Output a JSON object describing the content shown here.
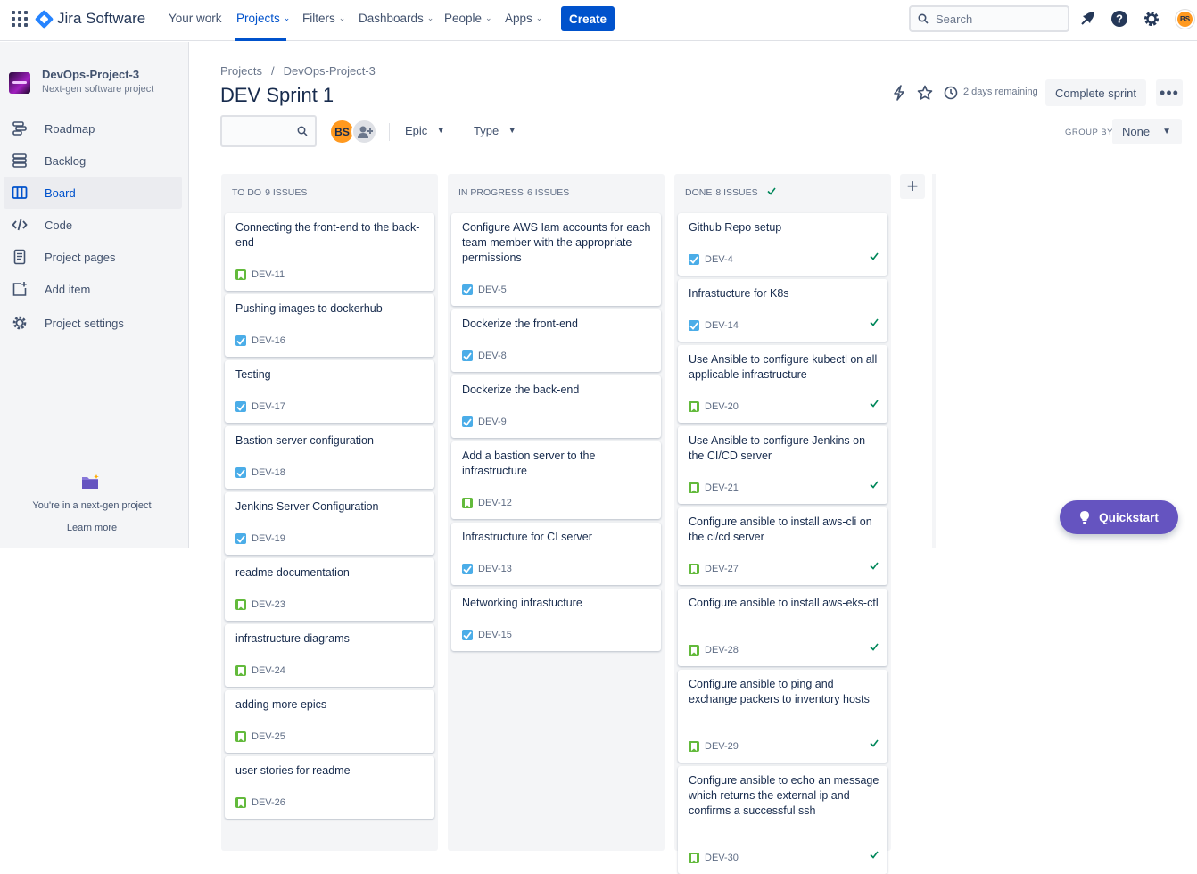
{
  "topnav": {
    "product": "Jira Software",
    "items": [
      {
        "label": "Your work",
        "chevron": false
      },
      {
        "label": "Projects",
        "chevron": true,
        "active": true
      },
      {
        "label": "Filters",
        "chevron": true
      },
      {
        "label": "Dashboards",
        "chevron": true
      },
      {
        "label": "People",
        "chevron": true
      },
      {
        "label": "Apps",
        "chevron": true
      }
    ],
    "create_label": "Create",
    "search_placeholder": "Search",
    "user_initials": "BS"
  },
  "sidebar": {
    "project_name": "DevOps-Project-3",
    "project_type": "Next-gen software project",
    "items": [
      {
        "label": "Roadmap",
        "icon": "roadmap-icon"
      },
      {
        "label": "Backlog",
        "icon": "backlog-icon"
      },
      {
        "label": "Board",
        "icon": "board-icon",
        "active": true
      },
      {
        "label": "Code",
        "icon": "code-icon"
      },
      {
        "label": "Project pages",
        "icon": "pages-icon"
      },
      {
        "label": "Add item",
        "icon": "add-item-icon"
      },
      {
        "label": "Project settings",
        "icon": "gear-icon"
      }
    ],
    "nextgen_text": "You're in a next-gen project",
    "learn_more": "Learn more"
  },
  "header": {
    "breadcrumb": [
      "Projects",
      "DevOps-Project-3"
    ],
    "title": "DEV Sprint 1",
    "days_remaining": "2 days remaining",
    "complete_sprint": "Complete sprint",
    "more_label": "•••"
  },
  "filters": {
    "search_value": "",
    "avatar_initials": "BS",
    "epic_label": "Epic",
    "type_label": "Type",
    "group_by_label": "GROUP BY",
    "group_by_value": "None"
  },
  "columns": [
    {
      "name": "TO DO",
      "count": "9 ISSUES",
      "done": false,
      "cards": [
        {
          "title": "Connecting the front-end to the back-end",
          "key": "DEV-11",
          "type": "story"
        },
        {
          "title": "Pushing images to dockerhub",
          "key": "DEV-16",
          "type": "task"
        },
        {
          "title": "Testing",
          "key": "DEV-17",
          "type": "task"
        },
        {
          "title": "Bastion server configuration",
          "key": "DEV-18",
          "type": "task"
        },
        {
          "title": "Jenkins Server Configuration",
          "key": "DEV-19",
          "type": "task"
        },
        {
          "title": "readme documentation",
          "key": "DEV-23",
          "type": "story"
        },
        {
          "title": "infrastructure diagrams",
          "key": "DEV-24",
          "type": "story"
        },
        {
          "title": "adding more epics",
          "key": "DEV-25",
          "type": "story"
        },
        {
          "title": "user stories for readme",
          "key": "DEV-26",
          "type": "story"
        }
      ]
    },
    {
      "name": "IN PROGRESS",
      "count": "6 ISSUES",
      "done": false,
      "cards": [
        {
          "title": "Configure AWS Iam accounts for each team member with the appropriate permissions",
          "key": "DEV-5",
          "type": "task"
        },
        {
          "title": "Dockerize the front-end",
          "key": "DEV-8",
          "type": "task"
        },
        {
          "title": "Dockerize the back-end",
          "key": "DEV-9",
          "type": "task"
        },
        {
          "title": "Add a bastion server to the infrastructure",
          "key": "DEV-12",
          "type": "story"
        },
        {
          "title": "Infrastructure for CI server",
          "key": "DEV-13",
          "type": "task"
        },
        {
          "title": "Networking infrastucture",
          "key": "DEV-15",
          "type": "task"
        }
      ]
    },
    {
      "name": "DONE",
      "count": "8 ISSUES",
      "done": true,
      "cards": [
        {
          "title": "Github Repo setup",
          "key": "DEV-4",
          "type": "task"
        },
        {
          "title": "Infrastucture for K8s",
          "key": "DEV-14",
          "type": "task"
        },
        {
          "title": "Use Ansible to configure kubectl on all applicable infrastructure",
          "key": "DEV-20",
          "type": "story"
        },
        {
          "title": "Use Ansible to configure Jenkins on the CI/CD server",
          "key": "DEV-21",
          "type": "story"
        },
        {
          "title": "Configure ansible to install aws-cli on the ci/cd server",
          "key": "DEV-27",
          "type": "story"
        },
        {
          "title": "Configure ansible to install aws-eks-ctl",
          "key": "DEV-28",
          "type": "story"
        },
        {
          "title": "Configure ansible to ping and exchange packers to inventory hosts",
          "key": "DEV-29",
          "type": "story"
        },
        {
          "title": "Configure ansible to echo an message which returns the external ip and confirms a successful ssh",
          "key": "DEV-30",
          "type": "story"
        }
      ]
    }
  ],
  "quickstart_label": "Quickstart",
  "colors": {
    "primary": "#0052cc",
    "task": "#4bade8",
    "story": "#63ba3c",
    "done": "#00875a",
    "quickstart": "#6554c0",
    "avatar": "#ff991f"
  }
}
